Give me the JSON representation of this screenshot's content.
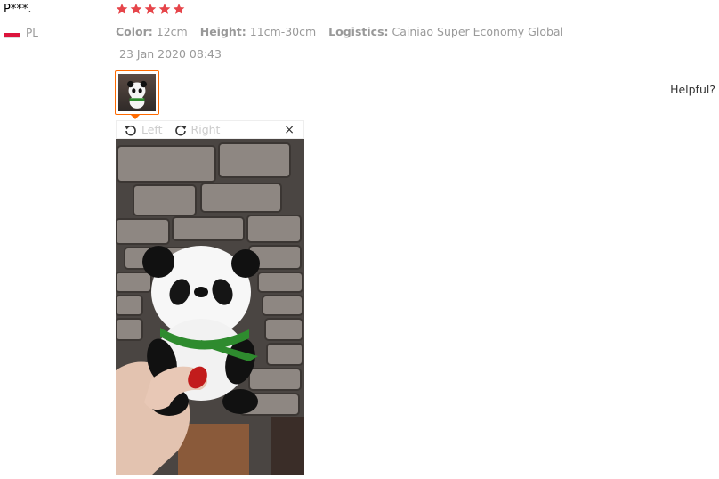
{
  "reviewer": {
    "name": "P***.",
    "country": "PL"
  },
  "rating": {
    "stars": 5,
    "max": 5,
    "color": "#e6454a"
  },
  "attributes": [
    {
      "key": "Color:",
      "value": "12cm"
    },
    {
      "key": "Height:",
      "value": "11cm-30cm"
    },
    {
      "key": "Logistics:",
      "value": "Cainiao Super Economy Global"
    }
  ],
  "date": "23 Jan 2020 08:43",
  "helpful_label": "Helpful?",
  "viewer": {
    "rotate_left": "Left",
    "rotate_right": "Right",
    "close": "×"
  },
  "colors": {
    "accent": "#ff6a00"
  }
}
